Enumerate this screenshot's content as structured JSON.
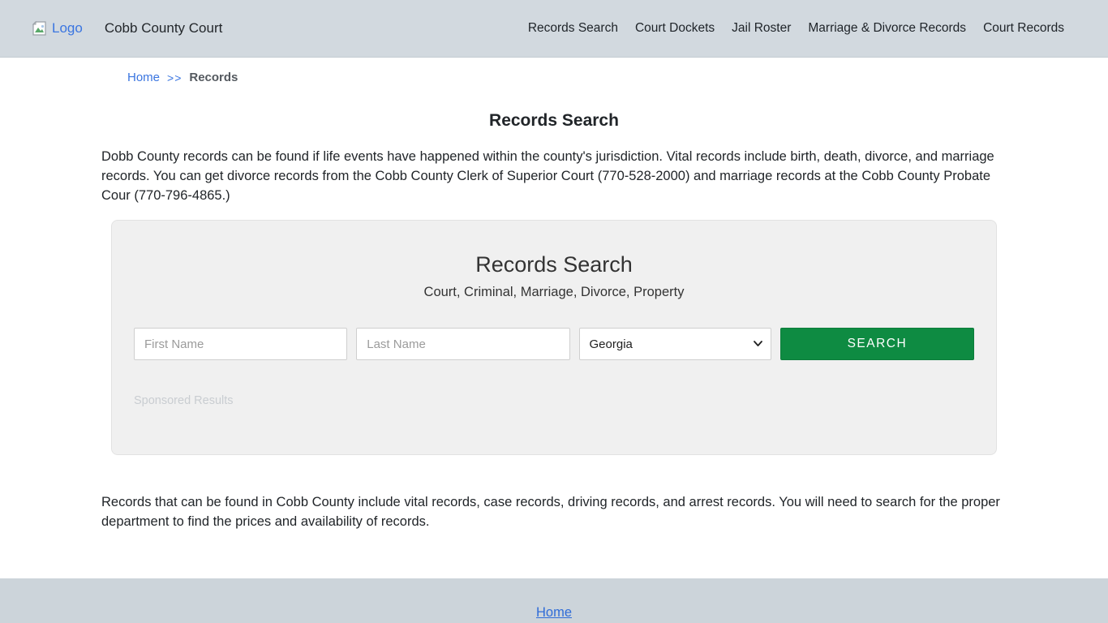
{
  "header": {
    "logo_alt": "Logo",
    "brand": "Cobb County Court",
    "nav": [
      "Records Search",
      "Court Dockets",
      "Jail Roster",
      "Marriage & Divorce Records",
      "Court Records"
    ]
  },
  "breadcrumb": {
    "home": "Home",
    "separator": ">>",
    "current": "Records"
  },
  "page": {
    "title": "Records Search",
    "intro": "Dobb County records can be found if life events have happened within the county's jurisdiction. Vital records include birth, death, divorce, and marriage records. You can get divorce records from the Cobb County Clerk of Superior Court (770-528-2000) and marriage records at the Cobb County Probate Cour (770-796-4865.)",
    "outro": "Records that can be found in Cobb County include vital records, case records, driving records, and arrest records. You will need to search for the proper department to find the prices and availability of records."
  },
  "search_card": {
    "title": "Records Search",
    "subtitle": "Court, Criminal, Marriage, Divorce, Property",
    "first_name_placeholder": "First Name",
    "last_name_placeholder": "Last Name",
    "state_selected": "Georgia",
    "search_label": "SEARCH",
    "sponsored_label": "Sponsored Results"
  },
  "footer": {
    "home": "Home"
  },
  "colors": {
    "header_bg": "#d2d9df",
    "footer_bg": "#ccd4da",
    "accent_green": "#0e8b42",
    "link_blue": "#3a75e0",
    "card_bg": "#f0f0f0"
  }
}
